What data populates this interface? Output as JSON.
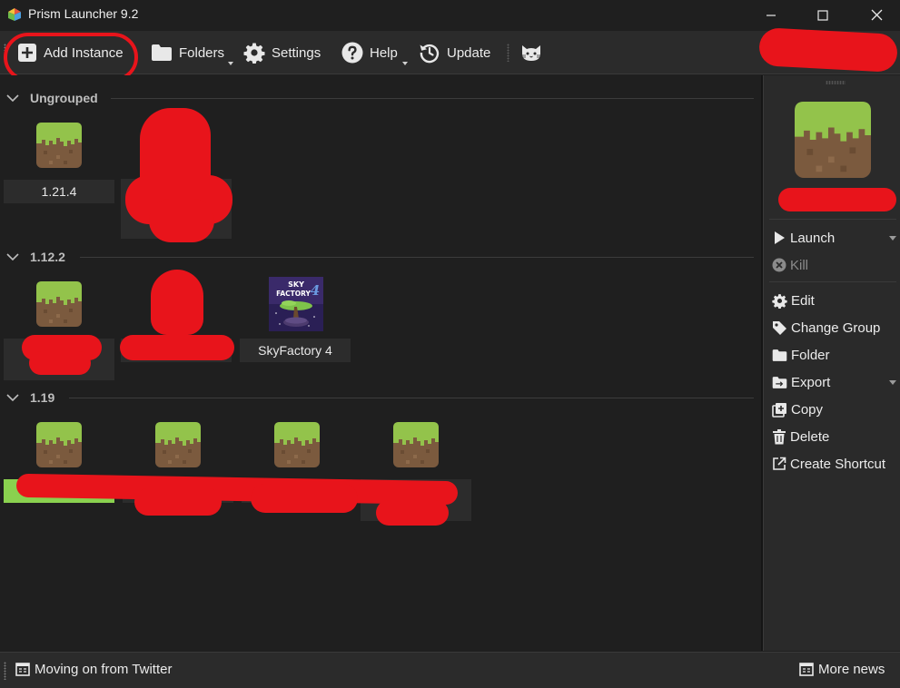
{
  "window": {
    "title": "Prism Launcher 9.2"
  },
  "toolbar": {
    "add_instance": "Add Instance",
    "folders": "Folders",
    "settings": "Settings",
    "help": "Help",
    "update": "Update"
  },
  "groups": [
    {
      "label": "Ungrouped",
      "instances": [
        {
          "name": "1.21.4",
          "icon": "grass-block-icon"
        },
        {
          "name": "",
          "icon": "grass-block-icon"
        }
      ]
    },
    {
      "label": "1.12.2",
      "instances": [
        {
          "name": "",
          "icon": "grass-block-icon"
        },
        {
          "name": "",
          "icon": "grass-block-icon"
        },
        {
          "name": "SkyFactory 4",
          "icon": "skyfactory-4-icon"
        }
      ]
    },
    {
      "label": "1.19",
      "instances": [
        {
          "name": "",
          "icon": "grass-block-icon"
        },
        {
          "name": "",
          "icon": "grass-block-icon"
        },
        {
          "name": "",
          "icon": "grass-block-icon"
        },
        {
          "name": "",
          "icon": "grass-block-icon"
        }
      ]
    }
  ],
  "skyfactory_art": {
    "line1": "SKY",
    "line2": "FACTORY",
    "numeral": "4"
  },
  "sidebar": {
    "launch": "Launch",
    "kill": "Kill",
    "edit": "Edit",
    "change_group": "Change Group",
    "folder": "Folder",
    "export": "Export",
    "copy": "Copy",
    "delete": "Delete",
    "create_shortcut": "Create Shortcut"
  },
  "status": {
    "news_item": "Moving on from Twitter",
    "more_news": "More news"
  },
  "colors": {
    "selection": "#8ad14f",
    "redaction": "#e8141b",
    "grass": "#93c34b",
    "dirt": "#7b5a3e"
  }
}
